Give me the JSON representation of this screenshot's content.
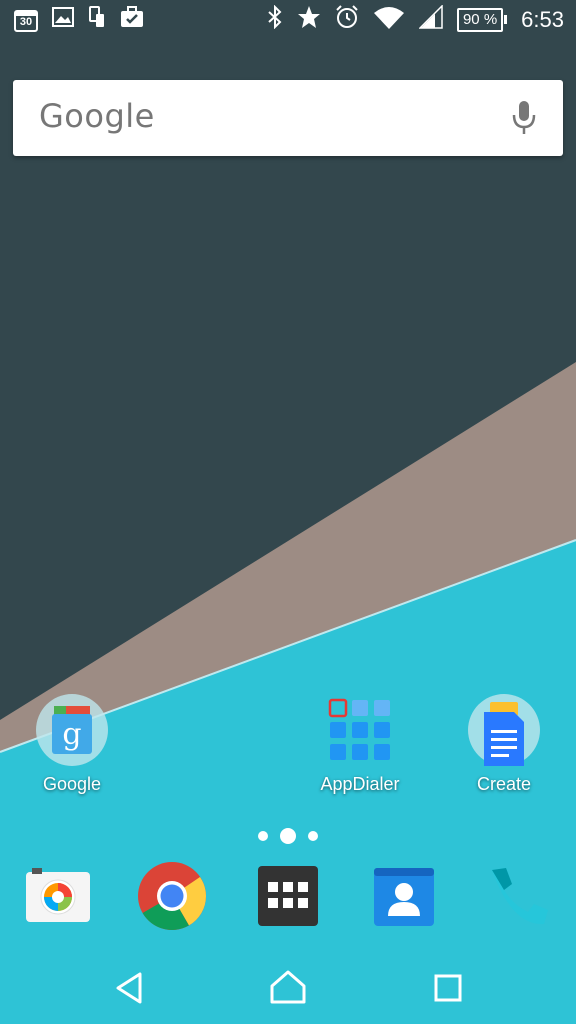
{
  "status_bar": {
    "left_icons": [
      "calendar-icon",
      "gallery-icon",
      "device-sync-icon",
      "work-briefcase-icon"
    ],
    "calendar_day": "30",
    "right_icons": [
      "bluetooth-icon",
      "star-icon",
      "alarm-icon",
      "wifi-icon",
      "cell-signal-icon"
    ],
    "battery": "90 %",
    "time": "6:53"
  },
  "search": {
    "logo": "Google",
    "mic_icon": "microphone-icon"
  },
  "home_apps": [
    {
      "label": "Google",
      "icon": "google-search-app-icon"
    },
    {
      "label": "AppDialer",
      "icon": "appdialer-grid-icon"
    },
    {
      "label": "Create",
      "icon": "create-document-icon"
    }
  ],
  "pages": {
    "count": 3,
    "current": 2
  },
  "dock": [
    {
      "name": "camera",
      "icon": "camera-icon"
    },
    {
      "name": "chrome",
      "icon": "chrome-icon"
    },
    {
      "name": "app-drawer",
      "icon": "app-drawer-icon"
    },
    {
      "name": "contacts",
      "icon": "contacts-icon"
    },
    {
      "name": "phone",
      "icon": "phone-icon"
    }
  ],
  "nav": [
    "back-icon",
    "home-icon",
    "recents-icon"
  ],
  "colors": {
    "wallpaper_dark": "#33474d",
    "wallpaper_tan": "#9d8c84",
    "wallpaper_cyan": "#2ec3d6",
    "accent_blue": "#2196f3"
  }
}
